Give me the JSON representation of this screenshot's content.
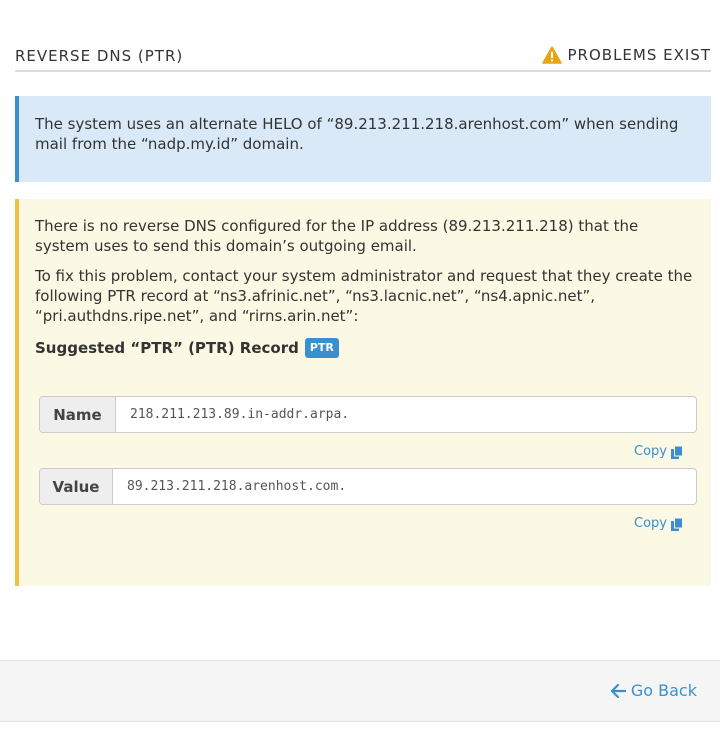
{
  "section": {
    "title": "REVERSE DNS (PTR)",
    "status_icon": "warning-triangle-icon",
    "status_text": "PROBLEMS EXIST",
    "status_color": "#e8a317"
  },
  "info": {
    "text": "The system uses an alternate HELO of “89.213.211.218.arenhost.com” when sending mail from the “nadp.my.id” domain."
  },
  "warning": {
    "p1": "There is no reverse DNS configured for the IP address (89.213.211.218) that the system uses to send this domain’s outgoing email.",
    "p2": "To fix this problem, contact your system administrator and request that they create the following PTR record at “ns3.afrinic.net”, “ns3.lacnic.net”, “ns4.apnic.net”, “pri.authdns.ripe.net”, and “rirns.arin.net”:",
    "suggested_label": "Suggested “PTR” (PTR) Record",
    "badge": "PTR"
  },
  "record": {
    "name_label": "Name",
    "name_value": "218.211.213.89.in-addr.arpa.",
    "value_label": "Value",
    "value_value": "89.213.211.218.arenhost.com.",
    "copy_label": "Copy"
  },
  "footer": {
    "go_back": "Go Back",
    "go_back_icon": "arrow-left-icon"
  },
  "colors": {
    "accent": "#3b8fd0",
    "info_bg": "#d9e9f7",
    "warn_bg": "#fbf8e3",
    "warn_border": "#f0c040"
  }
}
